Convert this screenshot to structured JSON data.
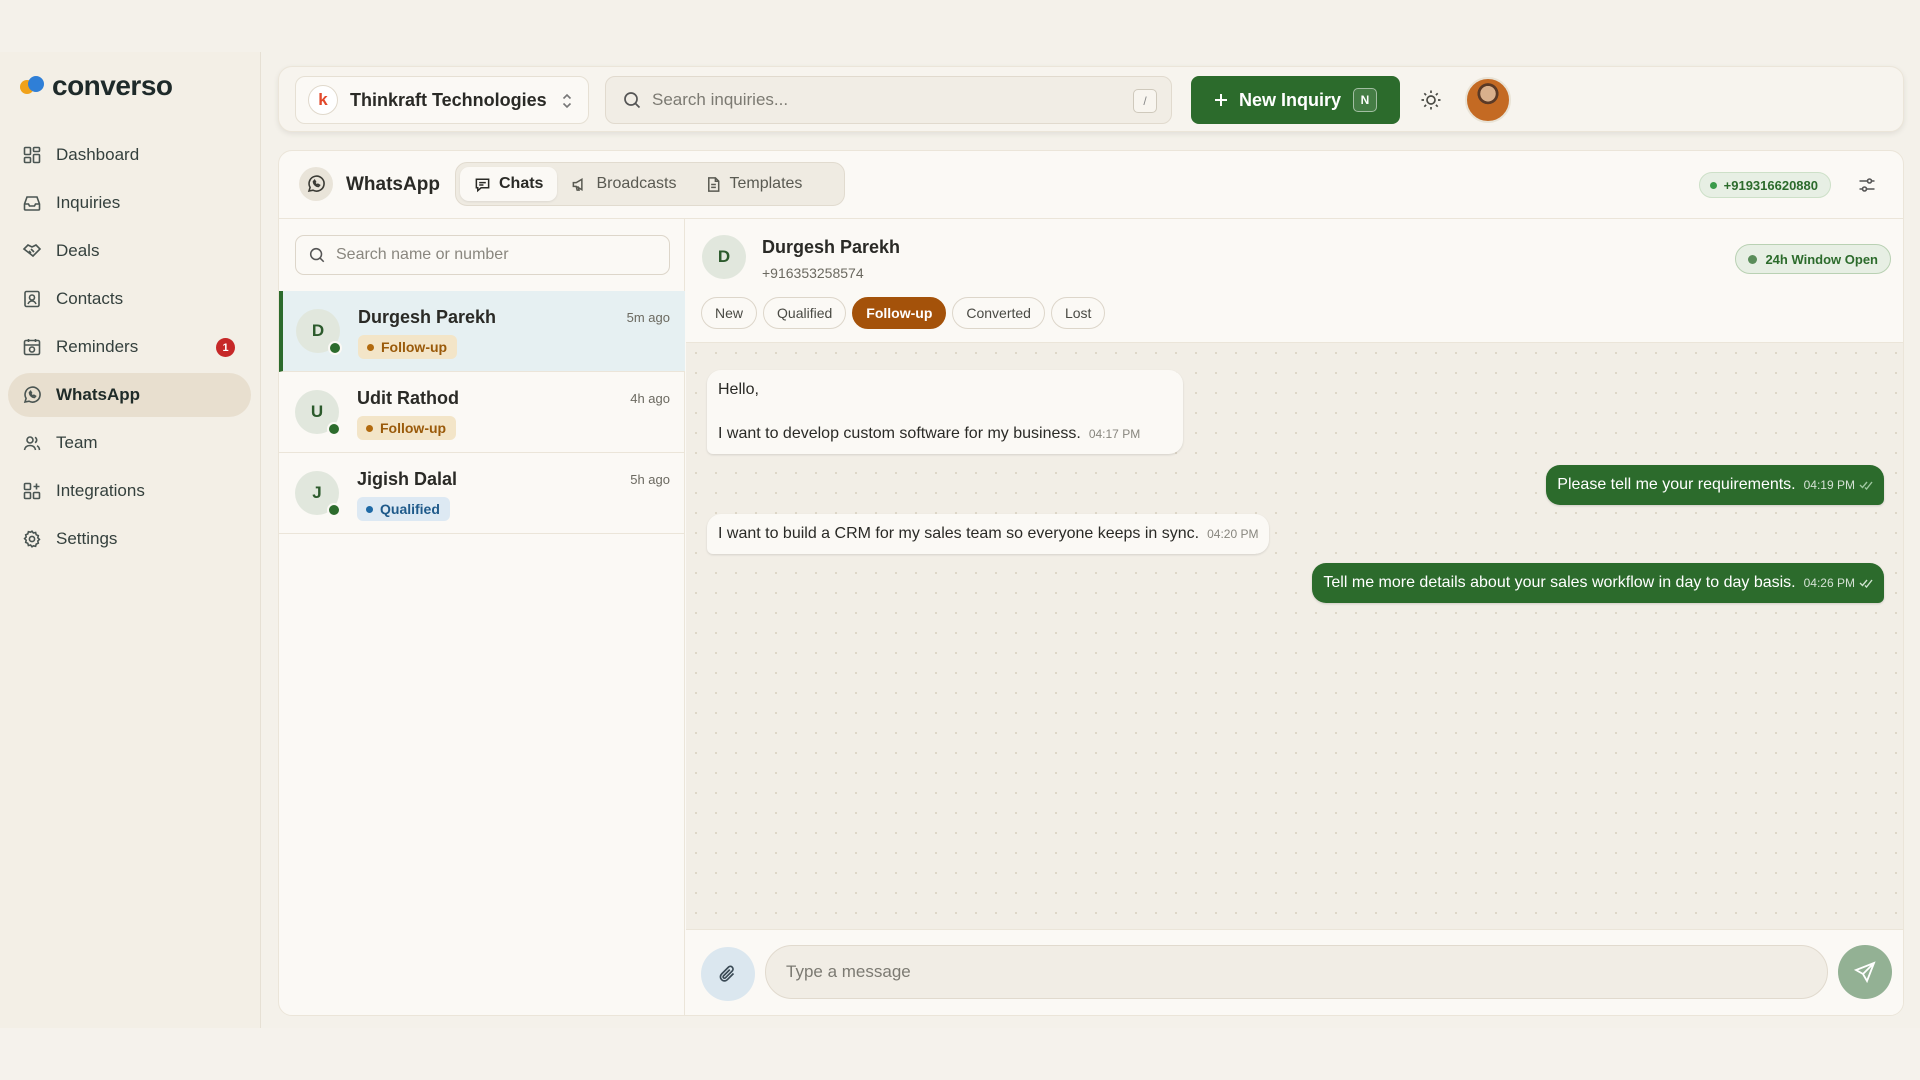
{
  "brand": {
    "name": "converso"
  },
  "sidebar": {
    "items": [
      {
        "label": "Dashboard",
        "icon": "dashboard-icon"
      },
      {
        "label": "Inquiries",
        "icon": "inbox-icon"
      },
      {
        "label": "Deals",
        "icon": "handshake-icon"
      },
      {
        "label": "Contacts",
        "icon": "contacts-icon"
      },
      {
        "label": "Reminders",
        "icon": "calendar-clock-icon",
        "badge": "1"
      },
      {
        "label": "WhatsApp",
        "icon": "whatsapp-icon",
        "active": true
      },
      {
        "label": "Team",
        "icon": "team-icon"
      },
      {
        "label": "Integrations",
        "icon": "integrations-icon"
      },
      {
        "label": "Settings",
        "icon": "gear-icon"
      }
    ]
  },
  "topbar": {
    "company_initial": "k",
    "company_name": "Thinkraft Technologies",
    "search_placeholder": "Search inquiries...",
    "search_shortcut": "/",
    "new_inquiry_label": "New Inquiry",
    "new_inquiry_shortcut": "N"
  },
  "panel": {
    "title": "WhatsApp",
    "tabs": [
      {
        "label": "Chats",
        "active": true
      },
      {
        "label": "Broadcasts"
      },
      {
        "label": "Templates"
      }
    ],
    "business_phone": "+919316620880"
  },
  "chatlist": {
    "search_placeholder": "Search name or number",
    "chats": [
      {
        "initial": "D",
        "name": "Durgesh Parekh",
        "time": "5m ago",
        "status": "Follow-up",
        "selected": true
      },
      {
        "initial": "U",
        "name": "Udit Rathod",
        "time": "4h ago",
        "status": "Follow-up"
      },
      {
        "initial": "J",
        "name": "Jigish Dalal",
        "time": "5h ago",
        "status": "Qualified"
      }
    ]
  },
  "conversation": {
    "contact_initial": "D",
    "contact_name": "Durgesh Parekh",
    "contact_phone": "+916353258574",
    "window_status": "24h Window Open",
    "stages": [
      "New",
      "Qualified",
      "Follow-up",
      "Converted",
      "Lost"
    ],
    "active_stage": "Follow-up",
    "messages": [
      {
        "dir": "in",
        "lines": [
          "Hello,",
          "I want to develop custom software for my business."
        ],
        "time": "04:17 PM"
      },
      {
        "dir": "out",
        "text": "Please tell me your requirements.",
        "time": "04:19 PM"
      },
      {
        "dir": "in",
        "text": "I want to build a CRM for my sales team so everyone keeps in sync.",
        "time": "04:20 PM"
      },
      {
        "dir": "out",
        "text": "Tell me more details about your sales workflow in day to day basis.",
        "time": "04:26 PM"
      }
    ],
    "composer_placeholder": "Type a message"
  },
  "colors": {
    "brand_green": "#2c6b2c",
    "follow_up": "#a4520a",
    "qualified": "#1f6aa6",
    "badge_red": "#c62828"
  }
}
